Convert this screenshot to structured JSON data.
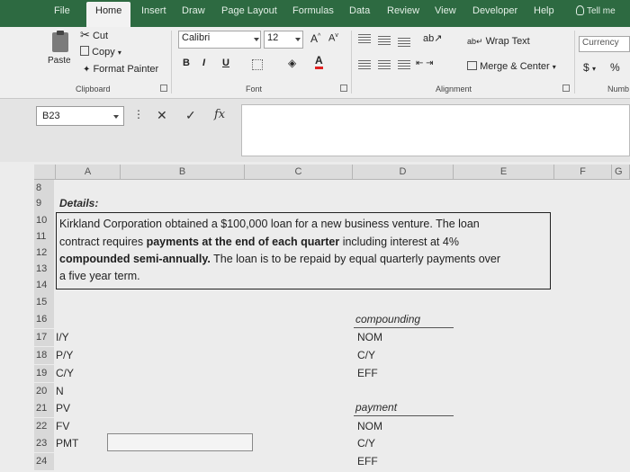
{
  "tabs": [
    "File",
    "Home",
    "Insert",
    "Draw",
    "Page Layout",
    "Formulas",
    "Data",
    "Review",
    "View",
    "Developer",
    "Help"
  ],
  "tell_me": "Tell me",
  "clipboard": {
    "cut": "Cut",
    "copy": "Copy",
    "paste": "Paste",
    "format_painter": "Format Painter",
    "group_label": "Clipboard"
  },
  "font": {
    "name": "Calibri",
    "size": "12",
    "bold": "B",
    "italic": "I",
    "underline": "U",
    "group_label": "Font"
  },
  "alignment": {
    "wrap_text": "Wrap Text",
    "merge_center": "Merge & Center",
    "group_label": "Alignment"
  },
  "number": {
    "format": "Currency",
    "currency_symbol": "$",
    "percent": "%",
    "group_label": "Numb"
  },
  "formula_bar": {
    "name_box": "B23",
    "fx": "fx",
    "cancel": "✕",
    "enter": "✓"
  },
  "columns": [
    "A",
    "B",
    "C",
    "D",
    "E",
    "F",
    "G"
  ],
  "rows": [
    "8",
    "9",
    "10",
    "11",
    "12",
    "13",
    "14",
    "15",
    "16",
    "17",
    "18",
    "19",
    "20",
    "21",
    "22",
    "23",
    "24"
  ],
  "details_label": "Details:",
  "paragraph": [
    {
      "normal": "Kirkland Corporation obtained a $100,000 loan for a new business venture.  The loan",
      "bold": "",
      "rest": ""
    },
    {
      "normal": "contract requires ",
      "bold": "payments at the end of each quarter",
      "rest": " including interest at 4%"
    },
    {
      "normal": "",
      "bold": "compounded semi-annually.",
      "rest": "  The loan is to be repaid by equal quarterly payments over"
    },
    {
      "normal": "a five year term.",
      "bold": "",
      "rest": ""
    }
  ],
  "labels_a": [
    {
      "row": "17",
      "text": "I/Y"
    },
    {
      "row": "18",
      "text": "P/Y"
    },
    {
      "row": "19",
      "text": "C/Y"
    },
    {
      "row": "20",
      "text": "N"
    },
    {
      "row": "21",
      "text": "PV"
    },
    {
      "row": "22",
      "text": "FV"
    },
    {
      "row": "23",
      "text": "PMT"
    }
  ],
  "compounding": {
    "title": "compounding",
    "items": [
      "NOM",
      "C/Y",
      "EFF"
    ]
  },
  "payment": {
    "title": "payment",
    "items": [
      "NOM",
      "C/Y",
      "EFF"
    ]
  }
}
